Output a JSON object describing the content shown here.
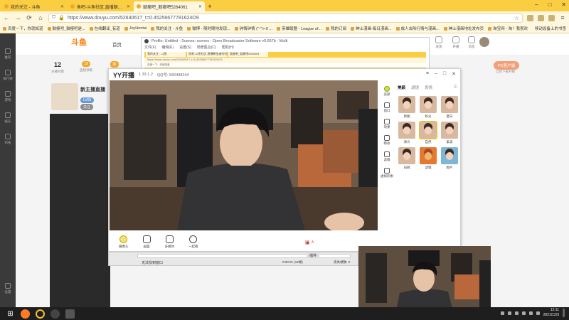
{
  "browser": {
    "tabs": [
      {
        "title": "我的关注 - 斗鱼",
        "active": false
      },
      {
        "title": "鱼吧-斗鱼社区,直播朝圣者的社区",
        "active": false
      },
      {
        "title": "鼓瘦吧_鼓瘦吧5264061",
        "active": true
      }
    ],
    "url": "https://www.douyu.com/5264061?_t=0.45256677781624O9",
    "bookmarks": [
      "百度一下，你就知道",
      "鼓瘦吧_鼓瘦吧是...",
      "在线翻译_有道",
      "JoyHentai",
      "我的关注 - 斗鱼",
      "微博 - 随时随地发现...",
      "钟情钟情 (\"-\"!>:0 ...",
      "英雄联盟 - League of...",
      "我的订阅",
      "绅士漫画-每日漫画...",
      "成人去除行情与漫画...",
      "绅士漫画地址发布页",
      "淘宝网 - 淘！我喜欢"
    ],
    "bookmarks_more": "移动设备上的书签"
  },
  "douyu": {
    "logo": "斗鱼",
    "nav": [
      "首页",
      "直播"
    ],
    "stats": [
      {
        "num": "12",
        "label": "主播对我"
      },
      {
        "num": "19",
        "label": "鱼翅领取"
      },
      {
        "num": "",
        "label": "主播等级"
      }
    ],
    "badge": "新",
    "rail": [
      "推荐",
      "排行榜",
      "游戏",
      "娱乐",
      "科技",
      "设置"
    ],
    "right_nav": [
      "发现",
      "开播",
      "消息",
      "下载"
    ],
    "pc_button": "PC客户端",
    "pc_sub": "立即下载开播",
    "host_name": "新主播直播",
    "host_tag": "LV05",
    "host_tag2": "关注"
  },
  "obs": {
    "title": "Profile: Untitled - Scenes: scenes - Open Broadcaster Software v0.657b - Multi",
    "menu": [
      "文件(F)",
      "编辑(E)",
      "设置(S)",
      "场景集合(C)",
      "帮助(H)"
    ],
    "no_signal": "无法找到窗口",
    "scene_label": "插件",
    "time": "0:00:01 (12帧)",
    "dropped": "丢失帧数: 0"
  },
  "yy": {
    "logo": "YY开播",
    "version": "1.33.1.2",
    "qq": "QQ号: 582498244",
    "tools": [
      "摄像头",
      "画面",
      "多媒体",
      "一起看"
    ],
    "side": [
      "美颜",
      "窗口",
      "效果",
      "特效",
      "滤镜",
      "虚拟形象"
    ],
    "panel_tabs": [
      "美颜",
      "滤镜",
      "表情"
    ],
    "faces": [
      "原图",
      "秋分",
      "夏日",
      "清冷",
      "自然",
      "柔美",
      "白桃",
      "滤镜",
      "图片"
    ]
  },
  "taskbar": {
    "time": "12:11",
    "date": "2021/12/3"
  }
}
